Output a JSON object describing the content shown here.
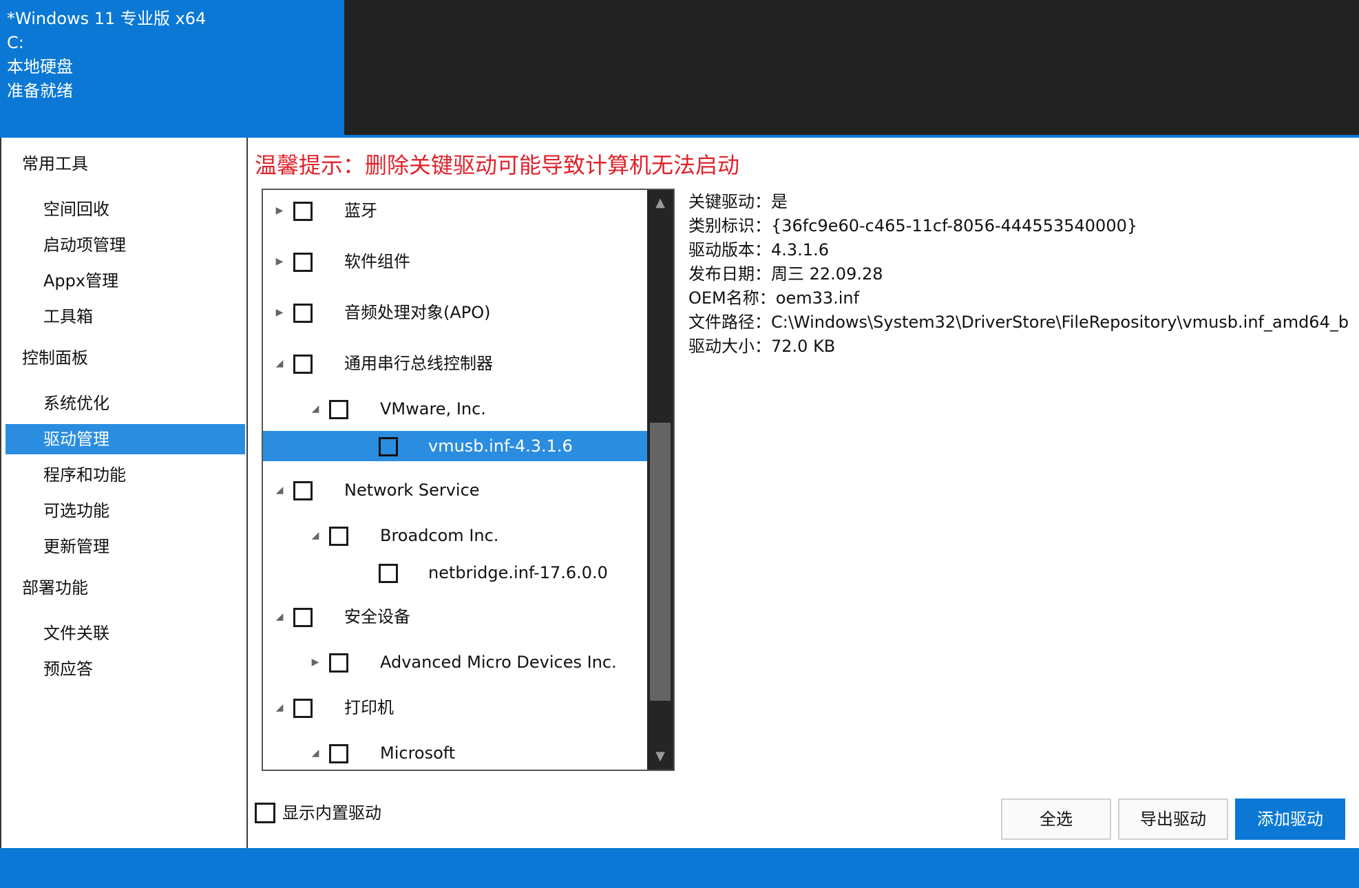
{
  "header": {
    "lines": [
      "*Windows 11 专业版 x64",
      "C:",
      "本地硬盘",
      "准备就绪"
    ]
  },
  "sidebar": {
    "groups": [
      {
        "label": "常用工具",
        "items": [
          "空间回收",
          "启动项管理",
          "Appx管理",
          "工具箱"
        ]
      },
      {
        "label": "控制面板",
        "items": [
          "系统优化",
          "驱动管理",
          "程序和功能",
          "可选功能",
          "更新管理"
        ]
      },
      {
        "label": "部署功能",
        "items": [
          "文件关联",
          "预应答"
        ]
      }
    ],
    "selected": "驱动管理"
  },
  "warning": "温馨提示：删除关键驱动可能导致计算机无法启动",
  "tree": {
    "rows": [
      {
        "label": "蓝牙",
        "level": 0,
        "expander": "collapsed"
      },
      {
        "label": "软件组件",
        "level": 0,
        "expander": "collapsed"
      },
      {
        "label": "音频处理对象(APO)",
        "level": 0,
        "expander": "collapsed"
      },
      {
        "label": "通用串行总线控制器",
        "level": 0,
        "expander": "expanded"
      },
      {
        "label": "VMware, Inc.",
        "level": 1,
        "expander": "expanded"
      },
      {
        "label": "vmusb.inf-4.3.1.6",
        "level": 2,
        "expander": "none",
        "selected": true
      },
      {
        "label": "Network Service",
        "level": 0,
        "expander": "expanded"
      },
      {
        "label": "Broadcom Inc.",
        "level": 1,
        "expander": "expanded"
      },
      {
        "label": "netbridge.inf-17.6.0.0",
        "level": 2,
        "expander": "none"
      },
      {
        "label": "安全设备",
        "level": 0,
        "expander": "expanded"
      },
      {
        "label": "Advanced Micro Devices Inc.",
        "level": 1,
        "expander": "collapsed"
      },
      {
        "label": "打印机",
        "level": 0,
        "expander": "expanded"
      },
      {
        "label": "Microsoft",
        "level": 1,
        "expander": "expanded"
      }
    ]
  },
  "details": [
    "关键驱动：是",
    "类别标识：{36fc9e60-c465-11cf-8056-444553540000}",
    "驱动版本：4.3.1.6",
    "发布日期：周三 22.09.28",
    "OEM名称：oem33.inf",
    "文件路径：C:\\Windows\\System32\\DriverStore\\FileRepository\\vmusb.inf_amd64_b",
    "驱动大小：72.0 KB"
  ],
  "show_builtin_label": "显示内置驱动",
  "buttons": {
    "select_all": "全选",
    "export": "导出驱动",
    "add": "添加驱动"
  },
  "icons": {
    "collapsed": "triangle-right-icon",
    "expanded": "triangle-down-right-icon",
    "scroll_up": "triangle-up-icon",
    "scroll_down": "triangle-down-icon"
  }
}
